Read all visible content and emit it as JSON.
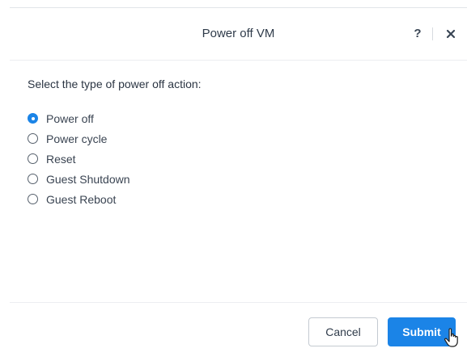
{
  "dialog": {
    "title": "Power off VM",
    "help_icon": "?",
    "close_icon": "close-icon"
  },
  "body": {
    "prompt": "Select the type of power off action:",
    "options": [
      {
        "label": "Power off",
        "checked": true
      },
      {
        "label": "Power cycle",
        "checked": false
      },
      {
        "label": "Reset",
        "checked": false
      },
      {
        "label": "Guest Shutdown",
        "checked": false
      },
      {
        "label": "Guest Reboot",
        "checked": false
      }
    ]
  },
  "footer": {
    "cancel_label": "Cancel",
    "submit_label": "Submit"
  },
  "colors": {
    "accent": "#1b84e7",
    "text": "#2f3b4a"
  }
}
